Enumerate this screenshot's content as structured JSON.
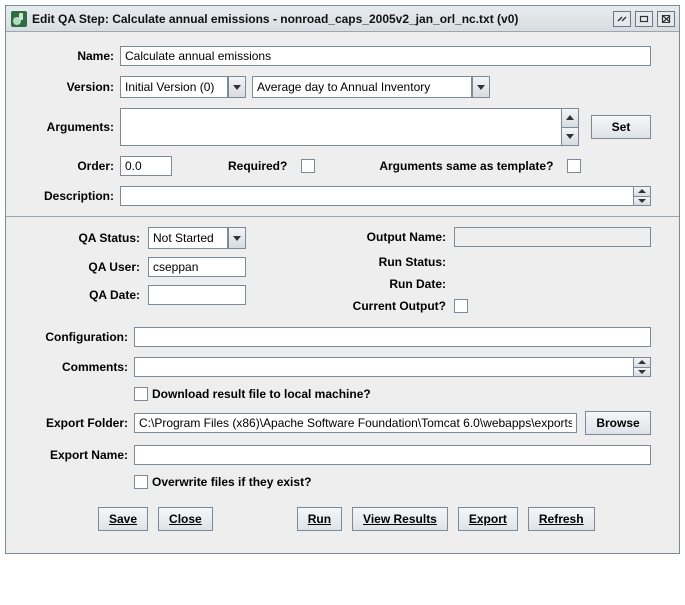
{
  "window": {
    "title": "Edit QA Step: Calculate annual emissions - nonroad_caps_2005v2_jan_orl_nc.txt (v0)"
  },
  "form": {
    "name_label": "Name:",
    "name_value": "Calculate annual emissions",
    "version_label": "Version:",
    "version_value": "Initial Version (0)",
    "program_value": "Average day to Annual Inventory",
    "arguments_label": "Arguments:",
    "arguments_value": "",
    "set_btn": "Set",
    "order_label": "Order:",
    "order_value": "0.0",
    "required_label": "Required?",
    "args_same_label": "Arguments same as template?",
    "description_label": "Description:",
    "description_value": ""
  },
  "status": {
    "qa_status_label": "QA Status:",
    "qa_status_value": "Not Started",
    "qa_user_label": "QA User:",
    "qa_user_value": "cseppan",
    "qa_date_label": "QA Date:",
    "qa_date_value": "",
    "output_name_label": "Output Name:",
    "output_name_value": "",
    "run_status_label": "Run Status:",
    "run_date_label": "Run Date:",
    "current_output_label": "Current Output?"
  },
  "config": {
    "configuration_label": "Configuration:",
    "configuration_value": "",
    "comments_label": "Comments:",
    "comments_value": "",
    "download_label": "Download result file to local machine?",
    "export_folder_label": "Export Folder:",
    "export_folder_value": "C:\\Program Files (x86)\\Apache Software Foundation\\Tomcat 6.0\\webapps\\exports",
    "browse_btn": "Browse",
    "export_name_label": "Export Name:",
    "export_name_value": "",
    "overwrite_label": "Overwrite files if they exist?"
  },
  "buttons": {
    "save": "Save",
    "close": "Close",
    "run": "Run",
    "view_results": "View Results",
    "export": "Export",
    "refresh": "Refresh"
  }
}
